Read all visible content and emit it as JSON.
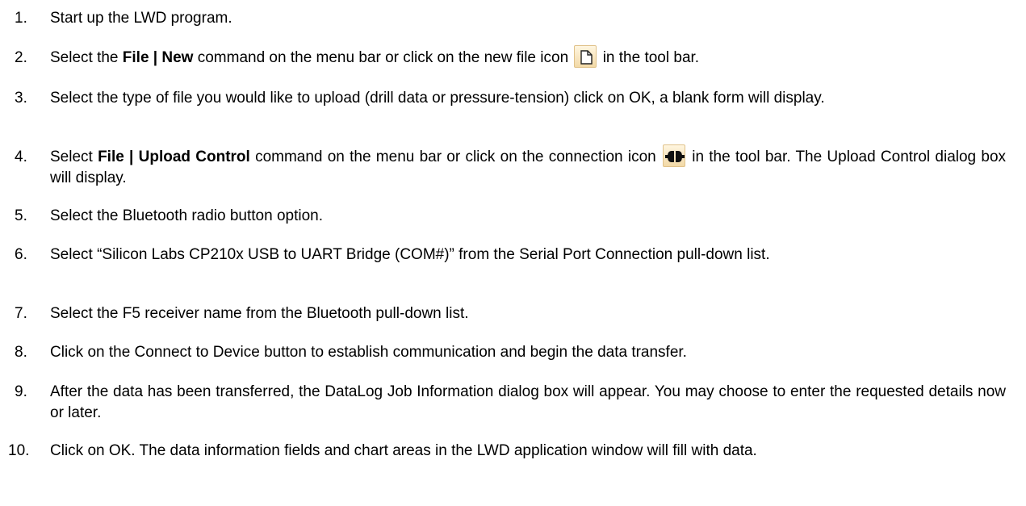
{
  "steps": [
    {
      "num": "1.",
      "parts": {
        "a": "Start up the LWD program."
      }
    },
    {
      "num": "2.",
      "parts": {
        "a": "Select the ",
        "b": "File | New",
        "c": " command on the menu bar or click on the new file icon ",
        "d": " in the tool bar."
      }
    },
    {
      "num": "3.",
      "parts": {
        "a": "Select the type of file you would like to upload (drill data or pressure-tension) click on OK, a blank form will display."
      }
    },
    {
      "num": "4.",
      "parts": {
        "a": "Select ",
        "b": "File | Upload Control",
        "c": " command on the menu bar or click on the connection icon ",
        "d": " in the tool bar. The Upload Control dialog box will display."
      }
    },
    {
      "num": "5.",
      "parts": {
        "a": "Select the Bluetooth radio button option."
      }
    },
    {
      "num": "6.",
      "parts": {
        "a": "Select “Silicon Labs CP210x USB to UART Bridge (COM#)” from the Serial Port Connection pull-down list."
      }
    },
    {
      "num": "7.",
      "parts": {
        "a": "Select the F5 receiver name from the Bluetooth pull-down list."
      }
    },
    {
      "num": "8.",
      "parts": {
        "a": "Click on the Connect to Device button to establish communication and begin the data transfer."
      }
    },
    {
      "num": "9.",
      "parts": {
        "a": "After the data has been transferred, the DataLog Job Information dialog box will appear. You may choose to enter the requested details now or later."
      }
    },
    {
      "num": "10.",
      "parts": {
        "a": "Click on OK. The data information fields and chart areas in the LWD application window will fill with data."
      }
    }
  ],
  "icons": {
    "new_file": "new-file-icon",
    "connection": "connection-icon"
  }
}
